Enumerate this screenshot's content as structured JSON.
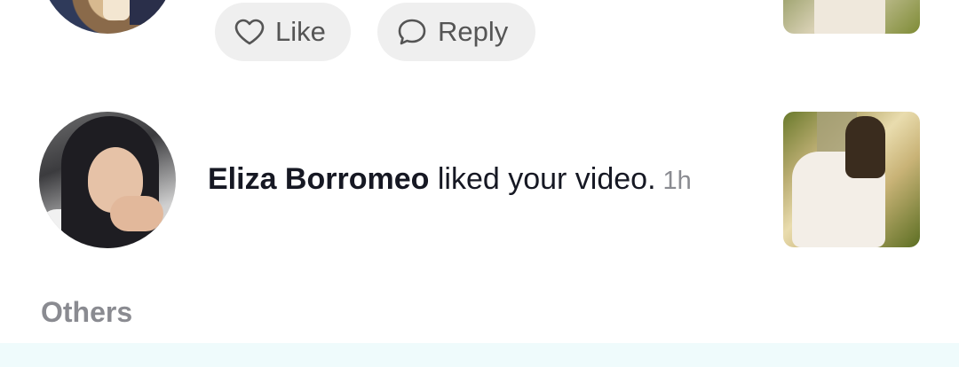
{
  "previous_notification": {
    "actions": {
      "like_label": "Like",
      "reply_label": "Reply"
    }
  },
  "notification": {
    "username": "Eliza Borromeo",
    "action_text": "liked your video.",
    "time": "1h"
  },
  "sections": {
    "others_label": "Others"
  },
  "colors": {
    "chip_bg": "#efefef",
    "time_text": "#8a8b91",
    "highlight_strip": "#effbfc"
  },
  "icons": {
    "like": "heart-outline-icon",
    "reply": "speech-bubble-icon"
  }
}
